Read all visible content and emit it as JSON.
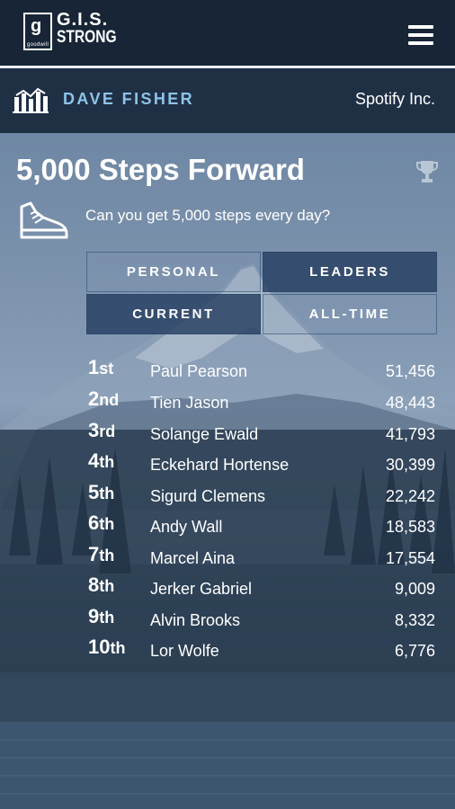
{
  "header": {
    "logo_line1": "G.I.S.",
    "logo_line2": "STRONG",
    "logo_small": "goodwill"
  },
  "user": {
    "name": "DAVE FISHER",
    "company": "Spotify Inc."
  },
  "challenge": {
    "title": "5,000 Steps Forward",
    "question": "Can you get 5,000 steps every day?"
  },
  "tabs": {
    "personal": "PERSONAL",
    "leaders": "LEADERS",
    "current": "CURRENT",
    "alltime": "ALL-TIME"
  },
  "leaderboard": [
    {
      "num": "1",
      "suf": "st",
      "name": "Paul Pearson",
      "steps": "51,456"
    },
    {
      "num": "2",
      "suf": "nd",
      "name": "Tien Jason",
      "steps": "48,443"
    },
    {
      "num": "3",
      "suf": "rd",
      "name": "Solange Ewald",
      "steps": "41,793"
    },
    {
      "num": "4",
      "suf": "th",
      "name": "Eckehard Hortense",
      "steps": "30,399"
    },
    {
      "num": "5",
      "suf": "th",
      "name": "Sigurd Clemens",
      "steps": "22,242"
    },
    {
      "num": "6",
      "suf": "th",
      "name": "Andy Wall",
      "steps": "18,583"
    },
    {
      "num": "7",
      "suf": "th",
      "name": "Marcel Aina",
      "steps": "17,554"
    },
    {
      "num": "8",
      "suf": "th",
      "name": "Jerker Gabriel",
      "steps": "9,009"
    },
    {
      "num": "9",
      "suf": "th",
      "name": "Alvin Brooks",
      "steps": "8,332"
    },
    {
      "num": "10",
      "suf": "th",
      "name": "Lor Wolfe",
      "steps": "6,776"
    }
  ],
  "icons": [
    "goodwill-logo-icon",
    "menu-icon",
    "bar-chart-icon",
    "trophy-icon",
    "shoe-icon"
  ],
  "colors": {
    "header_bg": "#172536",
    "accent": "#8ec3ea",
    "tab_active": "#263e60"
  }
}
